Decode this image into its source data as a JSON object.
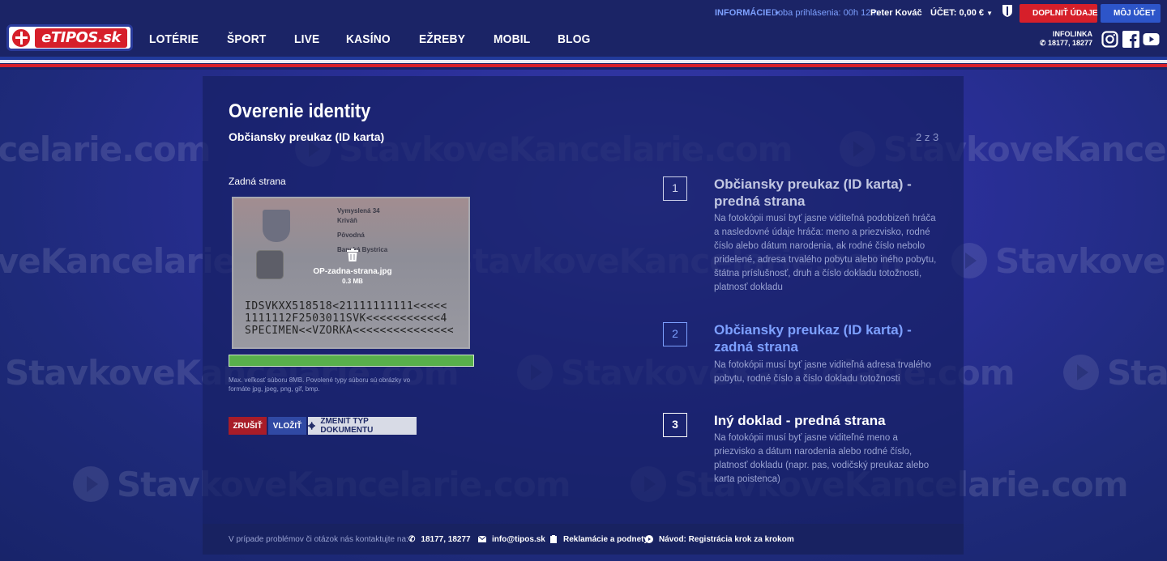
{
  "header": {
    "logo_text": "eTIPOS.sk",
    "nav": [
      "LOTÉRIE",
      "ŠPORT",
      "LIVE",
      "KASÍNO",
      "EŽREBY",
      "MOBIL",
      "BLOG"
    ],
    "info_label": "INFORMÁCIE",
    "session_label": "Doba prihlásenia: 00h 12m",
    "user_name": "Peter Kováč",
    "account_label": "ÚČET: 0,00 €",
    "complete_data_button": "DOPLNIŤ ÚDAJE",
    "my_account_button": "MÔJ ÚČET",
    "infolinka_label": "INFOLINKA",
    "infolinka_numbers": "18177, 18277",
    "colors": {
      "header_bg": "#1b2466",
      "red": "#d61f2a",
      "blue": "#2d55c9",
      "link": "#7da0ff"
    }
  },
  "watermark": {
    "text": "StavkoveKancelarie.com"
  },
  "page": {
    "title": "Overenie identity",
    "subtitle": "Občiansky preukaz (ID karta)",
    "step_counter": "2 z 3",
    "side_label": "Zadná strana",
    "upload": {
      "file_name": "OP-zadna-strana.jpg",
      "file_size": "0.3 MB",
      "progress": 1.0,
      "hint": "Max. veľkosť súboru 8MB. Povolené typy súboru sú obrázky vo formáte jpg, jpeg, png, gif, bmp."
    },
    "card": {
      "lines": [
        "Vymyslená 34",
        "Kriváň",
        "Pôvodná",
        "Banská Bystrica"
      ],
      "mrz": [
        "IDSVKXX518518<21111111111<<<<<",
        "1111112F2503011SVK<<<<<<<<<<<4",
        "SPECIMEN<<VZORKA<<<<<<<<<<<<<<<"
      ]
    },
    "buttons": {
      "cancel": "ZRUŠIŤ",
      "insert": "VLOŽIŤ",
      "change_type": "ZMENIŤ TYP DOKUMENTU"
    },
    "steps": [
      {
        "number": "1",
        "title": "Občiansky preukaz (ID karta) - predná strana",
        "text": "Na fotokópii musí byť jasne viditeľná podobizeň hráča a nasledovné údaje hráča: meno a priezvisko, rodné číslo alebo dátum narodenia, ak rodné číslo nebolo pridelené, adresa trvalého pobytu alebo iného pobytu, štátna príslušnosť, druh a číslo dokladu totožnosti, platnosť dokladu"
      },
      {
        "number": "2",
        "title": "Občiansky preukaz (ID karta) - zadná strana",
        "text": "Na fotokópii musí byť jasne viditeľná adresa trvalého pobytu, rodné číslo a číslo dokladu totožnosti"
      },
      {
        "number": "3",
        "title": "Iný doklad - predná strana",
        "text": "Na fotokópii musí byť jasne viditeľné meno a priezvisko a dátum narodenia alebo rodné číslo, platnosť dokladu (napr. pas, vodičský preukaz alebo karta poistenca)"
      }
    ]
  },
  "footer": {
    "question": "V prípade problémov či otázok nás kontaktujte na:",
    "phone": "18177, 18277",
    "email": "info@tipos.sk",
    "complaints": "Reklamácie a podnety",
    "guide": "Návod: Registrácia krok za krokom"
  }
}
